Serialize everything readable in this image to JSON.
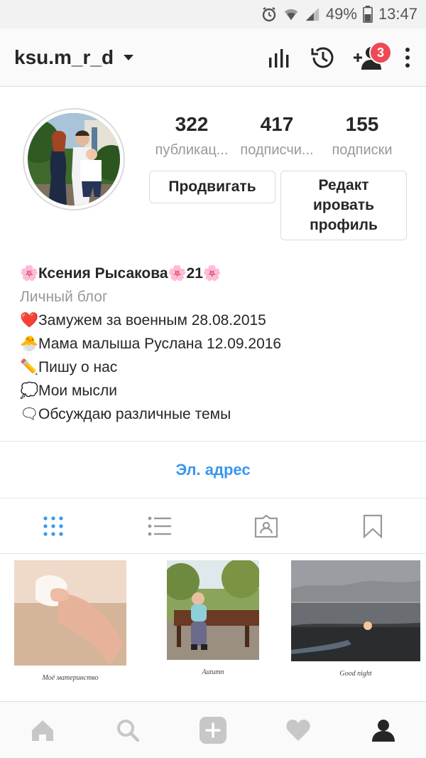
{
  "status_bar": {
    "battery": "49%",
    "time": "13:47",
    "icons": [
      "alarm-icon",
      "wifi-icon",
      "signal-icon",
      "battery-icon"
    ]
  },
  "top_bar": {
    "username": "ksu.m_r_d",
    "icons": [
      "insights-icon",
      "archive-history-icon",
      "discover-people-icon",
      "more-options-icon"
    ],
    "notification_badge": "3",
    "badge_color": "#ed4956"
  },
  "profile": {
    "stats": [
      {
        "value": "322",
        "label": "публикац..."
      },
      {
        "value": "417",
        "label": "подписчи..."
      },
      {
        "value": "155",
        "label": "подписки"
      }
    ],
    "promote_button": "Продвигать",
    "edit_button_lines": [
      "Редакт",
      "ировать",
      "профиль"
    ]
  },
  "bio": {
    "name": "Ксения Рысакова",
    "name_suffix": "21",
    "category": "Личный блог",
    "lines": [
      {
        "emoji": "❤️",
        "text": "Замужем за военным  28.08.2015"
      },
      {
        "emoji": "🐣",
        "text": "Мама малыша Руслана 12.09.2016"
      },
      {
        "emoji": "✏️",
        "text": "Пишу о нас"
      },
      {
        "emoji": "💭",
        "text": "Мои мысли"
      },
      {
        "emoji": "🗨",
        "text": "Обсуждаю различные темы"
      }
    ]
  },
  "contact": {
    "email_label": "Эл. адрес",
    "link_color": "#3897f0"
  },
  "tabs": [
    {
      "name": "grid-view-icon",
      "active": true
    },
    {
      "name": "list-view-icon",
      "active": false
    },
    {
      "name": "tagged-icon",
      "active": false
    },
    {
      "name": "saved-icon",
      "active": false
    }
  ],
  "posts": [
    {
      "caption": "Моё материнство"
    },
    {
      "caption": "Autumn"
    },
    {
      "caption": "Good night"
    }
  ],
  "bottom_nav": [
    "home-icon",
    "search-icon",
    "add-post-icon",
    "activity-heart-icon",
    "profile-icon"
  ],
  "accent_color": "#3897f0"
}
